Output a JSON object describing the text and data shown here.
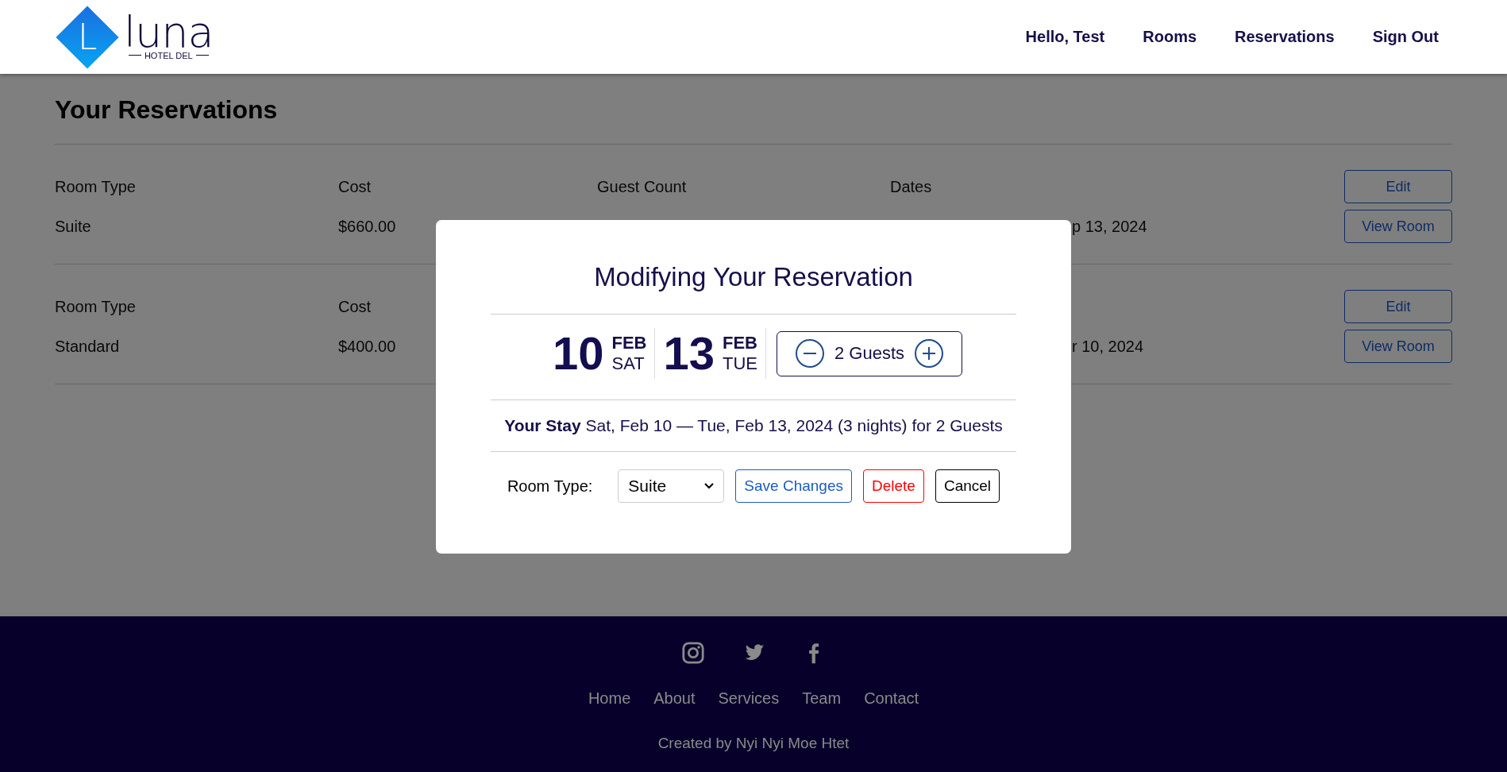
{
  "logo": {
    "letter": "L",
    "name": "luna",
    "tagline": "HOTEL DEL"
  },
  "nav": [
    "Hello, Test",
    "Rooms",
    "Reservations",
    "Sign Out"
  ],
  "page_title": "Your Reservations",
  "reservations": [
    {
      "cells": [
        {
          "kind": "room",
          "label": "Room Type",
          "value": "Suite"
        },
        {
          "kind": "cost",
          "label": "Cost",
          "value": "$660.00"
        },
        {
          "kind": "guests",
          "label": "Guest Count"
        },
        {
          "kind": "dates",
          "label": "Dates",
          "value": "p 13, 2024"
        }
      ],
      "buttons": [
        "Edit",
        "View Room"
      ]
    },
    {
      "cells": [
        {
          "kind": "room",
          "label": "Room Type",
          "value": "Standard"
        },
        {
          "kind": "cost",
          "label": "Cost",
          "value": "$400.00"
        },
        {
          "kind": "dates",
          "value": "r 10, 2024"
        }
      ],
      "buttons": [
        "Edit",
        "View Room"
      ]
    }
  ],
  "modal": {
    "title": "Modifying Your Reservation",
    "dates": [
      {
        "day": "10",
        "month": "FEB",
        "weekday": "SAT"
      },
      {
        "day": "13",
        "month": "FEB",
        "weekday": "TUE"
      }
    ],
    "guests": "2 Guests",
    "stay": "**Your Stay** Sat, Feb 10 — Tue, Feb 13, 2024 (3 nights) for 2 Guests",
    "room_type_label": "Room Type:",
    "room_type": "Suite",
    "buttons": [
      {
        "label": "Save Changes",
        "kind": "primary"
      },
      {
        "label": "Delete",
        "kind": "danger"
      },
      {
        "label": "Cancel",
        "kind": "plain"
      }
    ]
  },
  "footer": {
    "links": [
      "Home",
      "About",
      "Services",
      "Team",
      "Contact"
    ],
    "credit": "Created by Nyi Nyi Moe Htet"
  }
}
